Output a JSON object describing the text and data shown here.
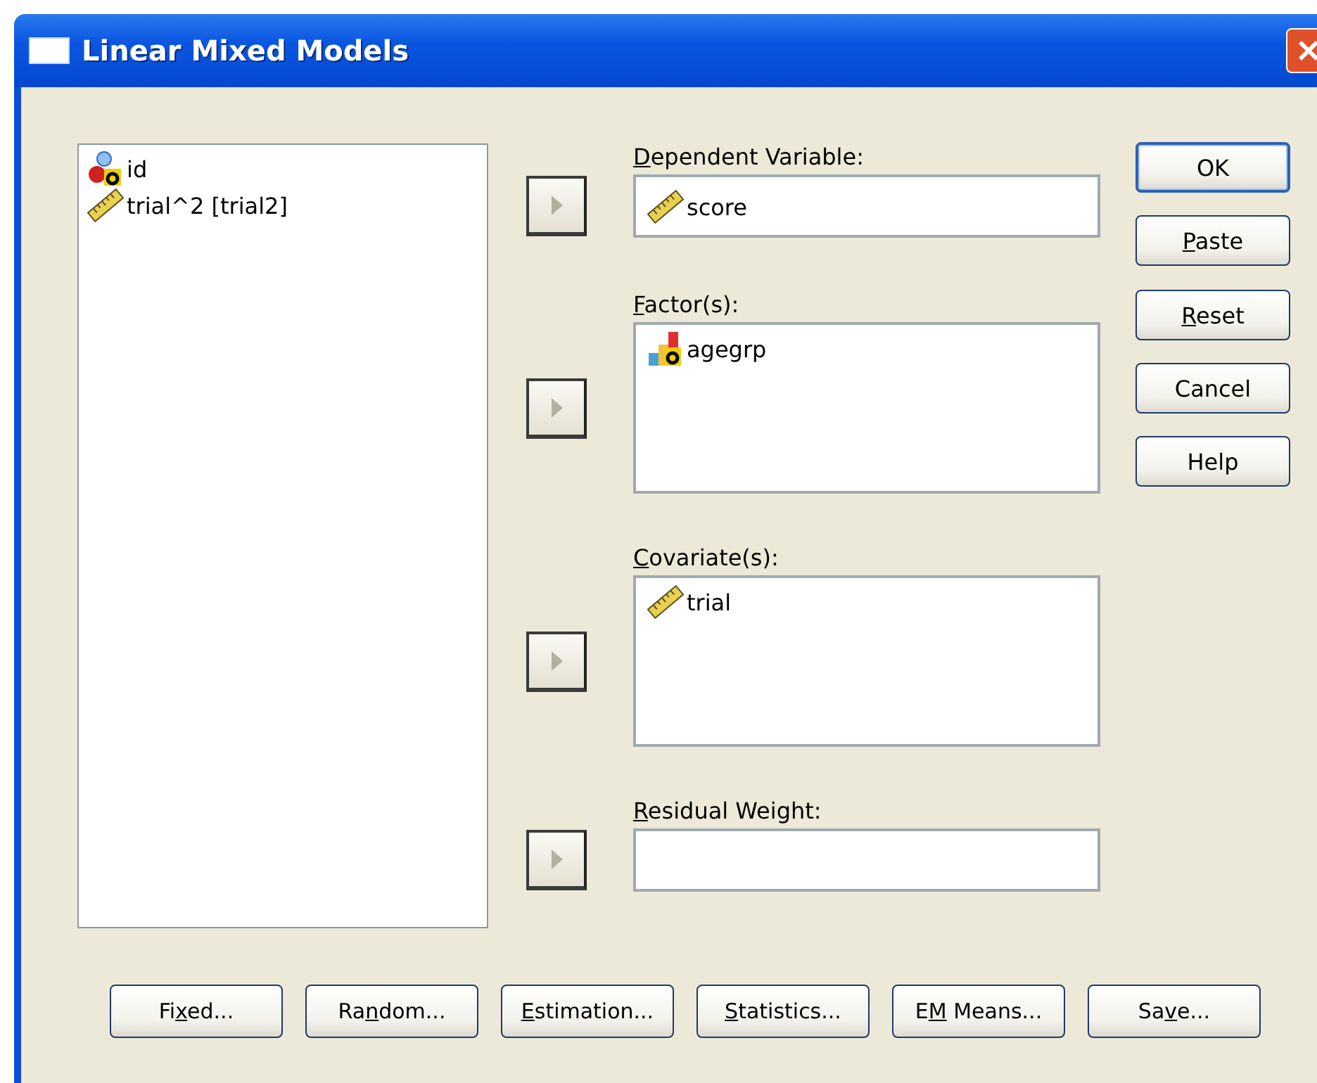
{
  "window": {
    "title": "Linear Mixed Models"
  },
  "source_list": {
    "items": [
      {
        "label": "id",
        "kind": "nominal"
      },
      {
        "label": "trial^2 [trial2]",
        "kind": "scale"
      }
    ]
  },
  "targets": [
    {
      "label": [
        {
          "text": "D",
          "underlined": true
        },
        {
          "text": "ependent Variable:",
          "underlined": false
        }
      ],
      "kind": "field",
      "arrow_disabled": true,
      "items": [
        {
          "label": "score",
          "kind": "scale"
        }
      ]
    },
    {
      "label": [
        {
          "text": "F",
          "underlined": true
        },
        {
          "text": "actor(s):",
          "underlined": false
        }
      ],
      "kind": "list",
      "arrow_disabled": true,
      "items": [
        {
          "label": "agegrp",
          "kind": "ordinal"
        }
      ]
    },
    {
      "label": [
        {
          "text": "C",
          "underlined": true
        },
        {
          "text": "ovariate(s):",
          "underlined": false
        }
      ],
      "kind": "list",
      "arrow_disabled": true,
      "items": [
        {
          "label": "trial",
          "kind": "scale"
        }
      ]
    },
    {
      "label": [
        {
          "text": "R",
          "underlined": true
        },
        {
          "text": "esidual Weight:",
          "underlined": false
        }
      ],
      "kind": "field",
      "arrow_disabled": true
    }
  ],
  "side_buttons": [
    {
      "label": [
        {
          "text": "OK",
          "underlined": false
        }
      ],
      "default": true
    },
    {
      "label": [
        {
          "text": "P",
          "underlined": true
        },
        {
          "text": "aste",
          "underlined": false
        }
      ],
      "default": false
    },
    {
      "label": [
        {
          "text": "R",
          "underlined": true
        },
        {
          "text": "eset",
          "underlined": false
        }
      ],
      "default": false
    },
    {
      "label": [
        {
          "text": "Cancel",
          "underlined": false
        }
      ],
      "default": false
    },
    {
      "label": [
        {
          "text": "Help",
          "underlined": false
        }
      ],
      "default": false
    }
  ],
  "bottom_buttons": [
    {
      "label": [
        {
          "text": "Fi",
          "underlined": false
        },
        {
          "text": "x",
          "underlined": true
        },
        {
          "text": "ed...",
          "underlined": false
        }
      ]
    },
    {
      "label": [
        {
          "text": "Ra",
          "underlined": false
        },
        {
          "text": "n",
          "underlined": true
        },
        {
          "text": "dom...",
          "underlined": false
        }
      ]
    },
    {
      "label": [
        {
          "text": "E",
          "underlined": true
        },
        {
          "text": "stimation...",
          "underlined": false
        }
      ]
    },
    {
      "label": [
        {
          "text": "S",
          "underlined": true
        },
        {
          "text": "tatistics...",
          "underlined": false
        }
      ]
    },
    {
      "label": [
        {
          "text": "E",
          "underlined": false
        },
        {
          "text": "M",
          "underlined": true
        },
        {
          "text": " Means...",
          "underlined": false
        }
      ]
    },
    {
      "label": [
        {
          "text": "Sa",
          "underlined": false
        },
        {
          "text": "v",
          "underlined": true
        },
        {
          "text": "e...",
          "underlined": false
        }
      ]
    }
  ]
}
